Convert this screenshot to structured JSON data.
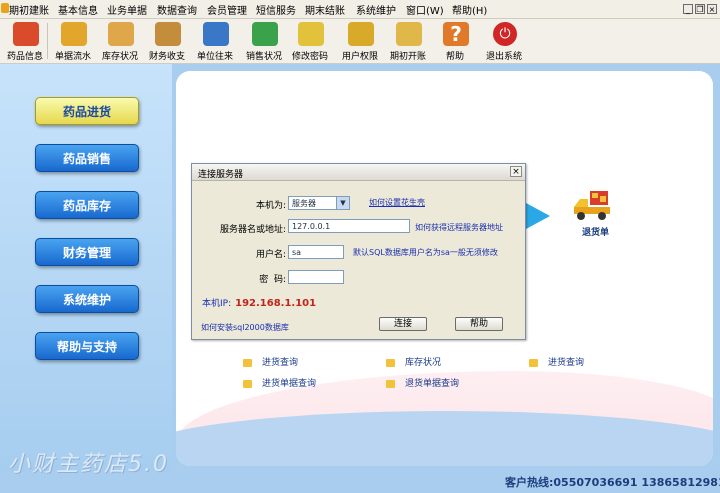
{
  "menu": {
    "items": [
      "期初建账",
      "基本信息",
      "业务单据",
      "数据查询",
      "会员管理",
      "短信服务",
      "期末结账",
      "系统维护",
      "窗口(W)",
      "帮助(H)"
    ]
  },
  "toolbar": {
    "items": [
      {
        "label": "药品信息",
        "icon": "medicine-info-icon",
        "color": "#d94b2b"
      },
      {
        "label": "单据流水",
        "icon": "document-flow-icon",
        "color": "#e3a62d"
      },
      {
        "label": "库存状况",
        "icon": "stock-box-icon",
        "color": "#e0a64a"
      },
      {
        "label": "财务收支",
        "icon": "finance-icon",
        "color": "#c48d3c"
      },
      {
        "label": "单位往来",
        "icon": "contacts-icon",
        "color": "#3b77c7"
      },
      {
        "label": "销售状况",
        "icon": "sales-chart-icon",
        "color": "#3aa24a"
      },
      {
        "label": "修改密码",
        "icon": "password-icon",
        "color": "#e2c23a"
      },
      {
        "label": "用户权限",
        "icon": "user-permission-icon",
        "color": "#d9a92a"
      },
      {
        "label": "期初开账",
        "icon": "open-account-icon",
        "color": "#e0b84a"
      },
      {
        "label": "帮助",
        "icon": "help-icon",
        "color": "#e07a2a"
      },
      {
        "label": "退出系统",
        "icon": "power-icon",
        "color": "#d02626"
      }
    ]
  },
  "sidebar": {
    "items": [
      "药品进货",
      "药品销售",
      "药品库存",
      "财务管理",
      "系统维护",
      "帮助与支持"
    ]
  },
  "flow": {
    "return_label": "退货单"
  },
  "quick_links": [
    "进货查询",
    "库存状况",
    "进货查询",
    "进货单据查询",
    "退货单据查询"
  ],
  "dialog": {
    "title": "连接服务器",
    "machine_label": "本机为:",
    "machine_value": "服务器",
    "set_link": "如何设置花生壳",
    "server_label": "服务器名或地址:",
    "server_value": "127.0.0.1",
    "remote_link": "如何获得远程服务器地址",
    "user_label": "用户名:",
    "user_value": "sa",
    "user_hint": "默认SQL数据库用户名为sa一般无须修改",
    "pwd_label": "密  码:",
    "pwd_value": "",
    "ip_label": "本机IP:",
    "ip_value": "192.168.1.101",
    "install_link": "如何安装sql2000数据库",
    "connect_label": "连接",
    "help_label": "帮助"
  },
  "watermark": "小财主药店5.0",
  "hotline": "客户热线:05507036691 13865812981",
  "colors": {
    "accent": "#1769cf",
    "active": "#e6d84c",
    "link": "#1b2fb0",
    "ip": "#c0241c"
  }
}
